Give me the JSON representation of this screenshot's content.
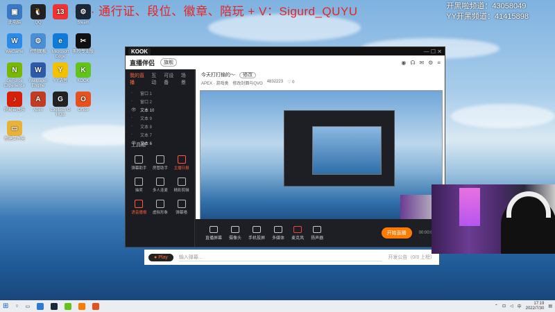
{
  "overlay": {
    "title": "接 · 通行证、段位、徽章、陪玩 + V：Sigurd_QUYU",
    "channel_lines": [
      "开黑啦频道：43058049",
      "YY开黑频道：41415898"
    ]
  },
  "desktop_icons": [
    {
      "name": "recycle-bin-icon",
      "label": "此电脑",
      "color": "#3a78c6",
      "glyph": "▣"
    },
    {
      "name": "qq-icon",
      "label": "QQ",
      "color": "#222",
      "glyph": "🐧"
    },
    {
      "name": "app13-icon",
      "label": "",
      "color": "#e33",
      "glyph": "13"
    },
    {
      "name": "steam-icon",
      "label": "Steam",
      "color": "#1b2838",
      "glyph": "⚙"
    },
    {
      "name": "wegame-icon",
      "label": "WeGame",
      "color": "#2c8be8",
      "glyph": "W"
    },
    {
      "name": "control-panel-icon",
      "label": "控制面板",
      "color": "#4a8fd6",
      "glyph": "⚙"
    },
    {
      "name": "edge-icon",
      "label": "Microsoft Edge",
      "color": "#0f7bd6",
      "glyph": "e"
    },
    {
      "name": "capcut-icon",
      "label": "剪映专业版",
      "color": "#111",
      "glyph": "✂"
    },
    {
      "name": "nvidia-icon",
      "label": "GeForce Experience",
      "color": "#76b900",
      "glyph": "N"
    },
    {
      "name": "wallpaper-icon",
      "label": "Wallpaper Engine",
      "color": "#2e5aa8",
      "glyph": "W"
    },
    {
      "name": "yy-icon",
      "label": "YY语音",
      "color": "#f2c200",
      "glyph": "Y"
    },
    {
      "name": "kook-icon",
      "label": "KOOK",
      "color": "#63c31b",
      "glyph": "K"
    },
    {
      "name": "netease-icon",
      "label": "网易云音乐",
      "color": "#d81e06",
      "glyph": "♪"
    },
    {
      "name": "apex-icon",
      "label": "Apex",
      "color": "#c23b22",
      "glyph": "A"
    },
    {
      "name": "logitech-icon",
      "label": "Logitech G HUB",
      "color": "#222",
      "glyph": "G"
    },
    {
      "name": "office-icon",
      "label": "Office",
      "color": "#e8501e",
      "glyph": "O"
    },
    {
      "name": "folder-icon",
      "label": "新建文件夹",
      "color": "#e8b23a",
      "glyph": "▭"
    }
  ],
  "app": {
    "logo": "KOOK",
    "name": "直播伴侣",
    "badge": "旗舰",
    "sidebar_tabs": [
      "我的直播",
      "互动",
      "可设备",
      "场景"
    ],
    "layers": [
      "窗口 1",
      "窗口 2",
      "文本 10",
      "文本 9",
      "文本 8",
      "文本 7",
      "文本 6"
    ],
    "tools_title": "工具箱",
    "tools": [
      {
        "label": "弹幕助手",
        "red": false
      },
      {
        "label": "房管助手",
        "red": false
      },
      {
        "label": "主播日报",
        "red": true
      },
      {
        "label": "抽奖",
        "red": false
      },
      {
        "label": "多人连麦",
        "red": false
      },
      {
        "label": "精彩剪辑",
        "red": false
      },
      {
        "label": "语音播报",
        "red": true
      },
      {
        "label": "虚拟形象",
        "red": false
      },
      {
        "label": "弹幕墙",
        "red": false
      }
    ],
    "stage_title": "今天打打输的～",
    "stage_tag": "修改",
    "stage_sub": [
      "APEX · 游戏类",
      "修改封面与QVO",
      "4832223",
      "♡ 0"
    ],
    "bottom_buttons": [
      "直播屏幕",
      "摄像头",
      "手机投屏",
      "多媒体",
      "麦克风",
      "扬声器"
    ],
    "start_live": "开始直播",
    "timer": "00:00:00"
  },
  "chat": {
    "placeholder": "输入弹幕...",
    "play_button": "Play",
    "notice": "开发公告（0/3 上榜）"
  },
  "taskbar": {
    "time": "17:19",
    "date": "2022/7/30",
    "lang": "中"
  }
}
